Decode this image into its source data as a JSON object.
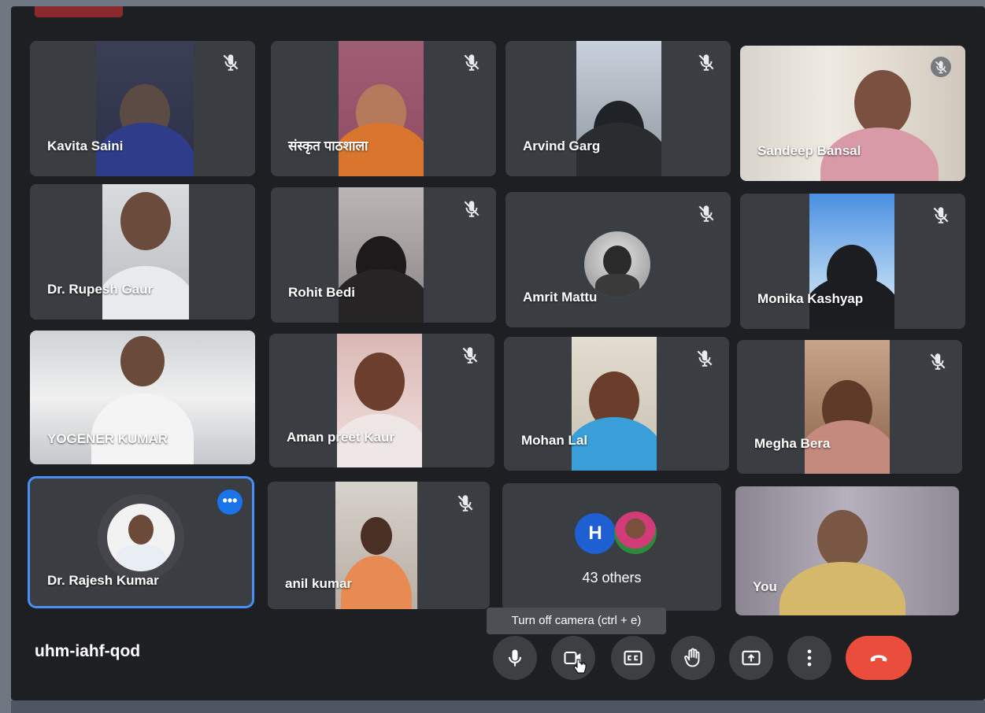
{
  "meeting": {
    "code": "uhm-iahf-qod",
    "tooltip": "Turn off camera (ctrl + e)"
  },
  "participants": [
    {
      "name": "Kavita Saini",
      "muted": true,
      "video": true
    },
    {
      "name": "संस्कृत पाठशाला",
      "muted": true,
      "video": true
    },
    {
      "name": "Arvind Garg",
      "muted": true,
      "video": true
    },
    {
      "name": "Sandeep Bansal",
      "muted": true,
      "video": true
    },
    {
      "name": "Dr. Rupesh Gaur",
      "muted": false,
      "video": true
    },
    {
      "name": "Rohit Bedi",
      "muted": true,
      "video": true
    },
    {
      "name": "Amrit Mattu",
      "muted": true,
      "video": false
    },
    {
      "name": "Monika Kashyap",
      "muted": true,
      "video": true
    },
    {
      "name": "YOGENER KUMAR",
      "muted": false,
      "video": true
    },
    {
      "name": "Aman preet Kaur",
      "muted": true,
      "video": true
    },
    {
      "name": "Mohan Lal",
      "muted": true,
      "video": true
    },
    {
      "name": "Megha Bera",
      "muted": true,
      "video": true
    },
    {
      "name": "Dr. Rajesh Kumar",
      "muted": false,
      "video": false,
      "active_speaker": true
    },
    {
      "name": "anil kumar",
      "muted": true,
      "video": true
    },
    {
      "name": "You",
      "muted": false,
      "video": true
    }
  ],
  "others": {
    "initial": "H",
    "label": "43 others"
  },
  "controls": [
    {
      "name": "microphone",
      "icon": "microphone-icon"
    },
    {
      "name": "camera",
      "icon": "camera-icon"
    },
    {
      "name": "captions",
      "icon": "captions-icon"
    },
    {
      "name": "raise-hand",
      "icon": "hand-icon"
    },
    {
      "name": "present",
      "icon": "present-screen-icon"
    },
    {
      "name": "more-options",
      "icon": "more-vertical-icon"
    },
    {
      "name": "leave-call",
      "icon": "hang-up-icon"
    }
  ],
  "colors": {
    "screen_bg": "#1d1f22",
    "tile_bg": "#3a3d42",
    "active_border": "#4a8ef5",
    "hangup": "#ea4d3c",
    "button": "#3c4043",
    "accent_blue": "#1a73e8"
  }
}
